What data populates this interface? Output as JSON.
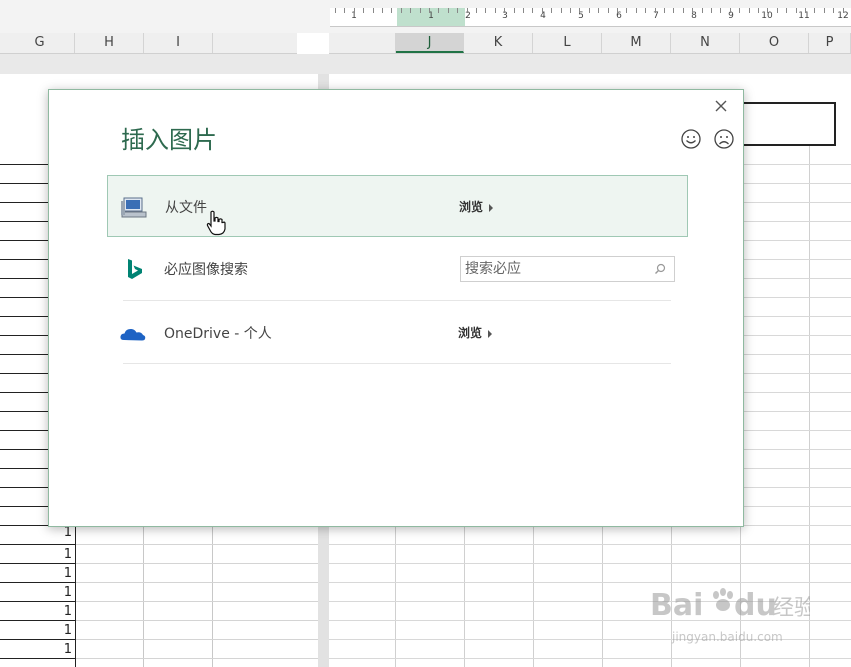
{
  "ruler": {
    "labels": [
      "1",
      "1",
      "2",
      "3",
      "4",
      "5",
      "6",
      "7",
      "8",
      "9",
      "10",
      "11",
      "12"
    ]
  },
  "left_columns": [
    "G",
    "H",
    "I"
  ],
  "right_columns": [
    "J",
    "K",
    "L",
    "M",
    "N",
    "O",
    "P"
  ],
  "selected_column": "J",
  "sheet_values": [
    "1",
    "1",
    "1",
    "1",
    "1",
    "1",
    "1"
  ],
  "dialog": {
    "title": "插入图片",
    "rows": [
      {
        "icon": "computer-icon",
        "label": "从文件",
        "action": "浏览"
      },
      {
        "icon": "bing-icon",
        "label": "必应图像搜索",
        "search_placeholder": "搜索必应"
      },
      {
        "icon": "onedrive-icon",
        "label": "OneDrive - 个人",
        "action": "浏览"
      }
    ]
  },
  "colors": {
    "accent": "#217346",
    "title": "#2e6a4f",
    "hover_bg": "#eef5f1",
    "bing": "#008373",
    "onedrive": "#1e63c4"
  },
  "watermark": {
    "brand": "Bai",
    "brand_tail": "du",
    "cn": "经验",
    "url": "jingyan.baidu.com"
  }
}
